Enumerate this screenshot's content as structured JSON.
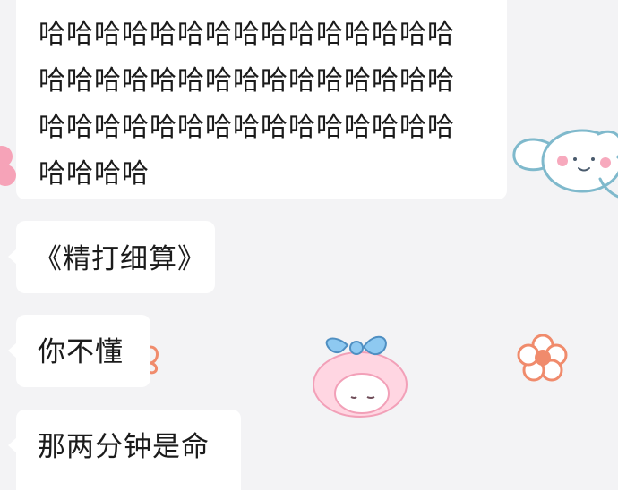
{
  "chat": {
    "messages": [
      {
        "lines": [
          "哈哈哈哈哈哈哈哈哈哈哈哈哈哈哈",
          "哈哈哈哈哈哈哈哈哈哈哈哈哈哈哈",
          "哈哈哈哈哈哈哈哈哈哈哈哈哈哈哈",
          "哈哈哈哈"
        ]
      },
      {
        "text": "《精打细算》"
      },
      {
        "text": "你不懂"
      },
      {
        "text": "那两分钟是命"
      }
    ]
  },
  "wallpaper": {
    "background_color": "#f3f3f5",
    "stickers": [
      "cinnamoroll-sticker",
      "my-melody-sticker",
      "flower-icon",
      "flower-icon",
      "flower-icon"
    ]
  }
}
